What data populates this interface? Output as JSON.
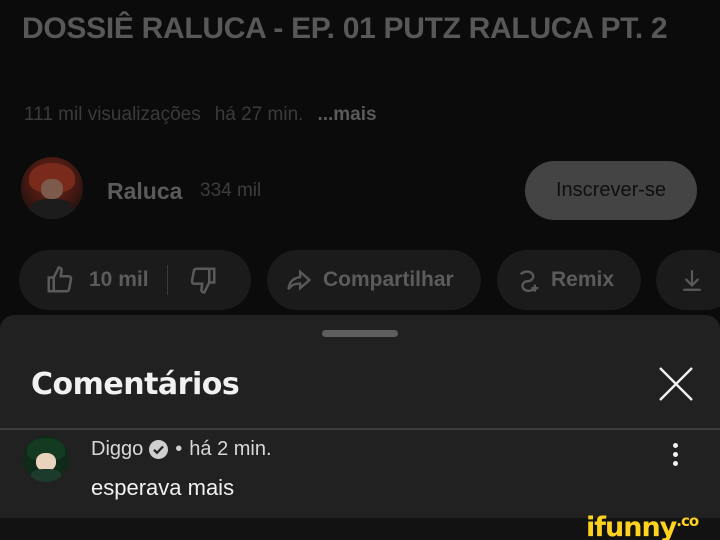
{
  "video": {
    "title": "DOSSIÊ RALUCA - EP. 01 PUTZ RALUCA PT. 2",
    "views": "111 mil visualizações",
    "time_ago": "há 27 min.",
    "more": "...mais"
  },
  "channel": {
    "name": "Raluca",
    "subscribers": "334 mil",
    "subscribe_label": "Inscrever-se"
  },
  "actions": {
    "like_count": "10 mil",
    "share_label": "Compartilhar",
    "remix_label": "Remix"
  },
  "comments_sheet": {
    "title": "Comentários",
    "comment": {
      "author": "Diggo",
      "separator": "•",
      "time": "há 2 min.",
      "text": "esperava mais"
    }
  },
  "watermark": {
    "text": "ifunny",
    "suffix": ".co"
  },
  "icons": [
    "thumbs-up-icon",
    "thumbs-down-icon",
    "share-icon",
    "remix-icon",
    "download-icon",
    "close-icon",
    "verified-icon",
    "more-vert-icon"
  ],
  "colors": {
    "sheet_bg": "#212121",
    "page_bg": "#0b0b0b",
    "watermark": "#ffd21f"
  }
}
